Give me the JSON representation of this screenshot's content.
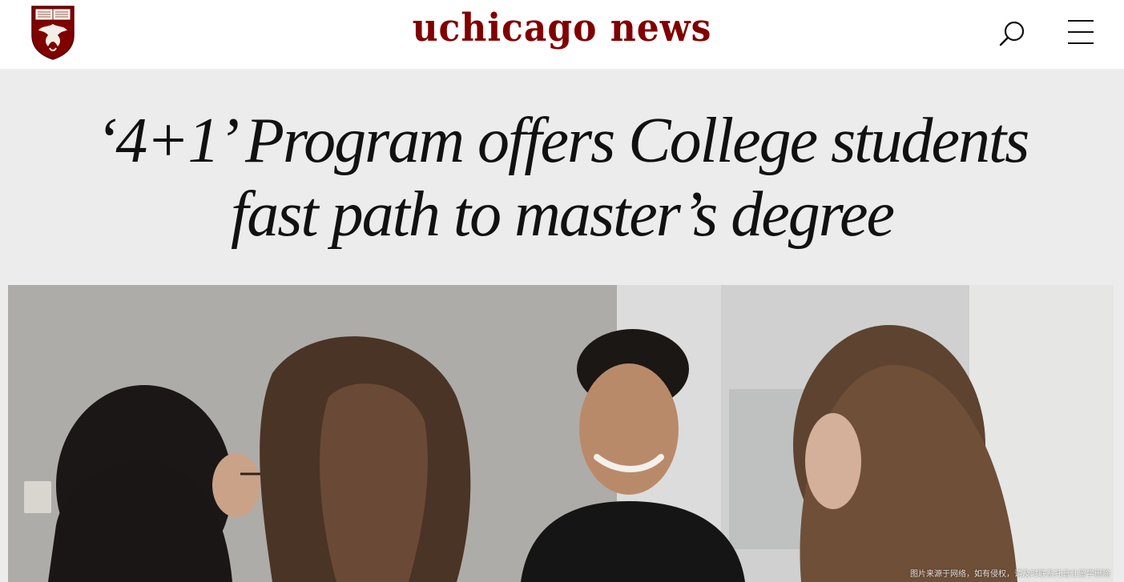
{
  "header": {
    "brand_text": "uchicago news",
    "search_icon": "search-icon",
    "menu_icon": "hamburger-menu-icon",
    "brand_color": "#800000"
  },
  "article": {
    "headline": "‘4+1’ Program offers College students fast path to master’s degree",
    "hero_image_caption_overlay": "图片来源于网络，如有侵权，请及时联系托普仕留学删除"
  },
  "colors": {
    "header_bg": "#ffffff",
    "title_band_bg": "#ececec",
    "crest_red": "#800000"
  }
}
